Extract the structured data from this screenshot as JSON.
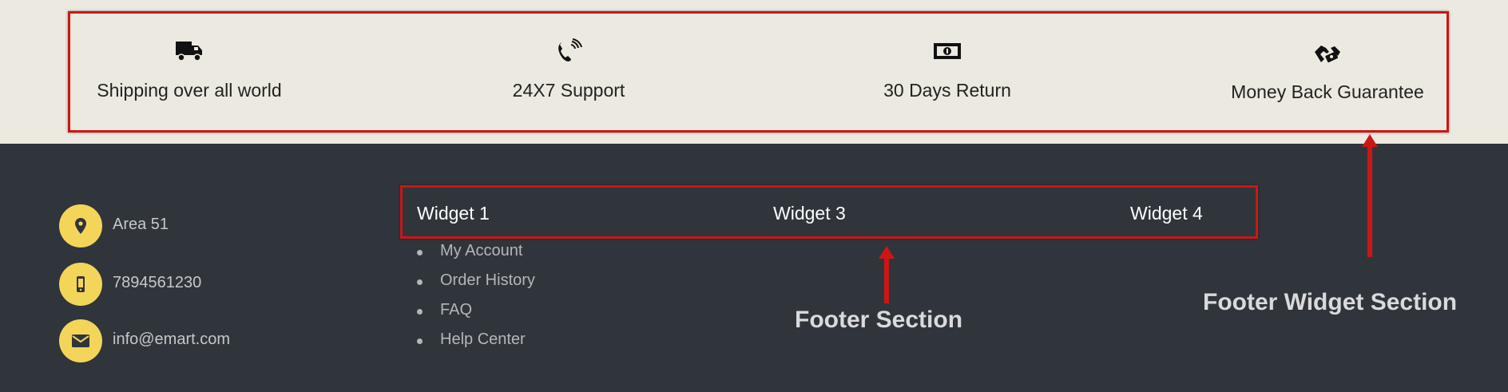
{
  "features": [
    {
      "label": "Shipping over all world",
      "icon": "truck-icon"
    },
    {
      "label": "24X7 Support",
      "icon": "phone-ringing-icon"
    },
    {
      "label": "30 Days Return",
      "icon": "money-bill-icon"
    },
    {
      "label": "Money Back Guarantee",
      "icon": "hand-holding-money-icon"
    }
  ],
  "footer": {
    "contacts": [
      {
        "text": "Area 51",
        "icon": "location-pin-icon"
      },
      {
        "text": "7894561230",
        "icon": "mobile-phone-icon"
      },
      {
        "text": "info@emart.com",
        "icon": "envelope-icon"
      }
    ],
    "widgets": [
      {
        "title": "Widget 1"
      },
      {
        "title": "Widget 3"
      },
      {
        "title": "Widget 4"
      }
    ],
    "links": [
      "My Account",
      "Order History",
      "FAQ",
      "Help Center"
    ]
  },
  "annotations": {
    "footer_section": "Footer Section",
    "footer_widget_section": "Footer Widget Section"
  },
  "colors": {
    "feature_bg": "#eceae0",
    "footer_bg": "#30353b",
    "accent_yellow": "#f3d559",
    "annotation_red": "#cc1616"
  }
}
